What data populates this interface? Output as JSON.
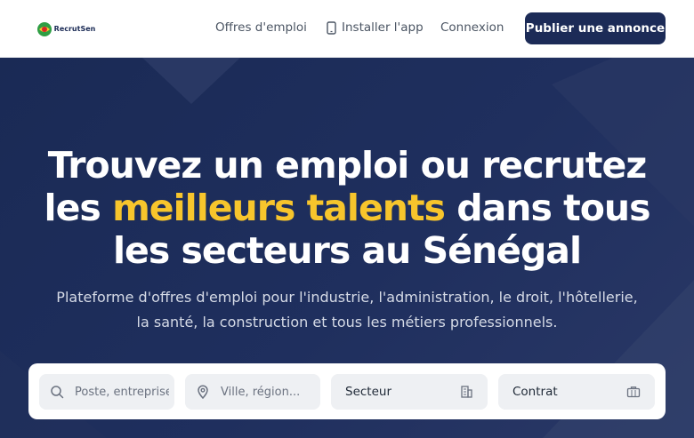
{
  "header": {
    "logo_text": "RecrutSen",
    "nav": {
      "offres": "Offres d'emploi",
      "install": "Installer l'app",
      "login": "Connexion"
    },
    "publish_label": "Publier une annonce"
  },
  "hero": {
    "title_line1": "Trouvez un emploi ou recrutez",
    "title_line2_prefix": "les ",
    "title_line2_accent": "meilleurs talents",
    "title_line2_suffix": " dans tous",
    "title_line3": "les secteurs au Sénégal",
    "subtitle_line1": "Plateforme d'offres d'emploi pour l'industrie, l'administration, le droit, l'hôtellerie,",
    "subtitle_line2": "la santé, la construction et tous les métiers professionnels."
  },
  "search": {
    "keyword_placeholder": "Poste, entreprise...",
    "location_placeholder": "Ville, région...",
    "sector_label": "Secteur",
    "contract_label": "Contrat"
  },
  "colors": {
    "brand_navy": "#1c2b57",
    "accent_yellow": "#f7c52c"
  }
}
